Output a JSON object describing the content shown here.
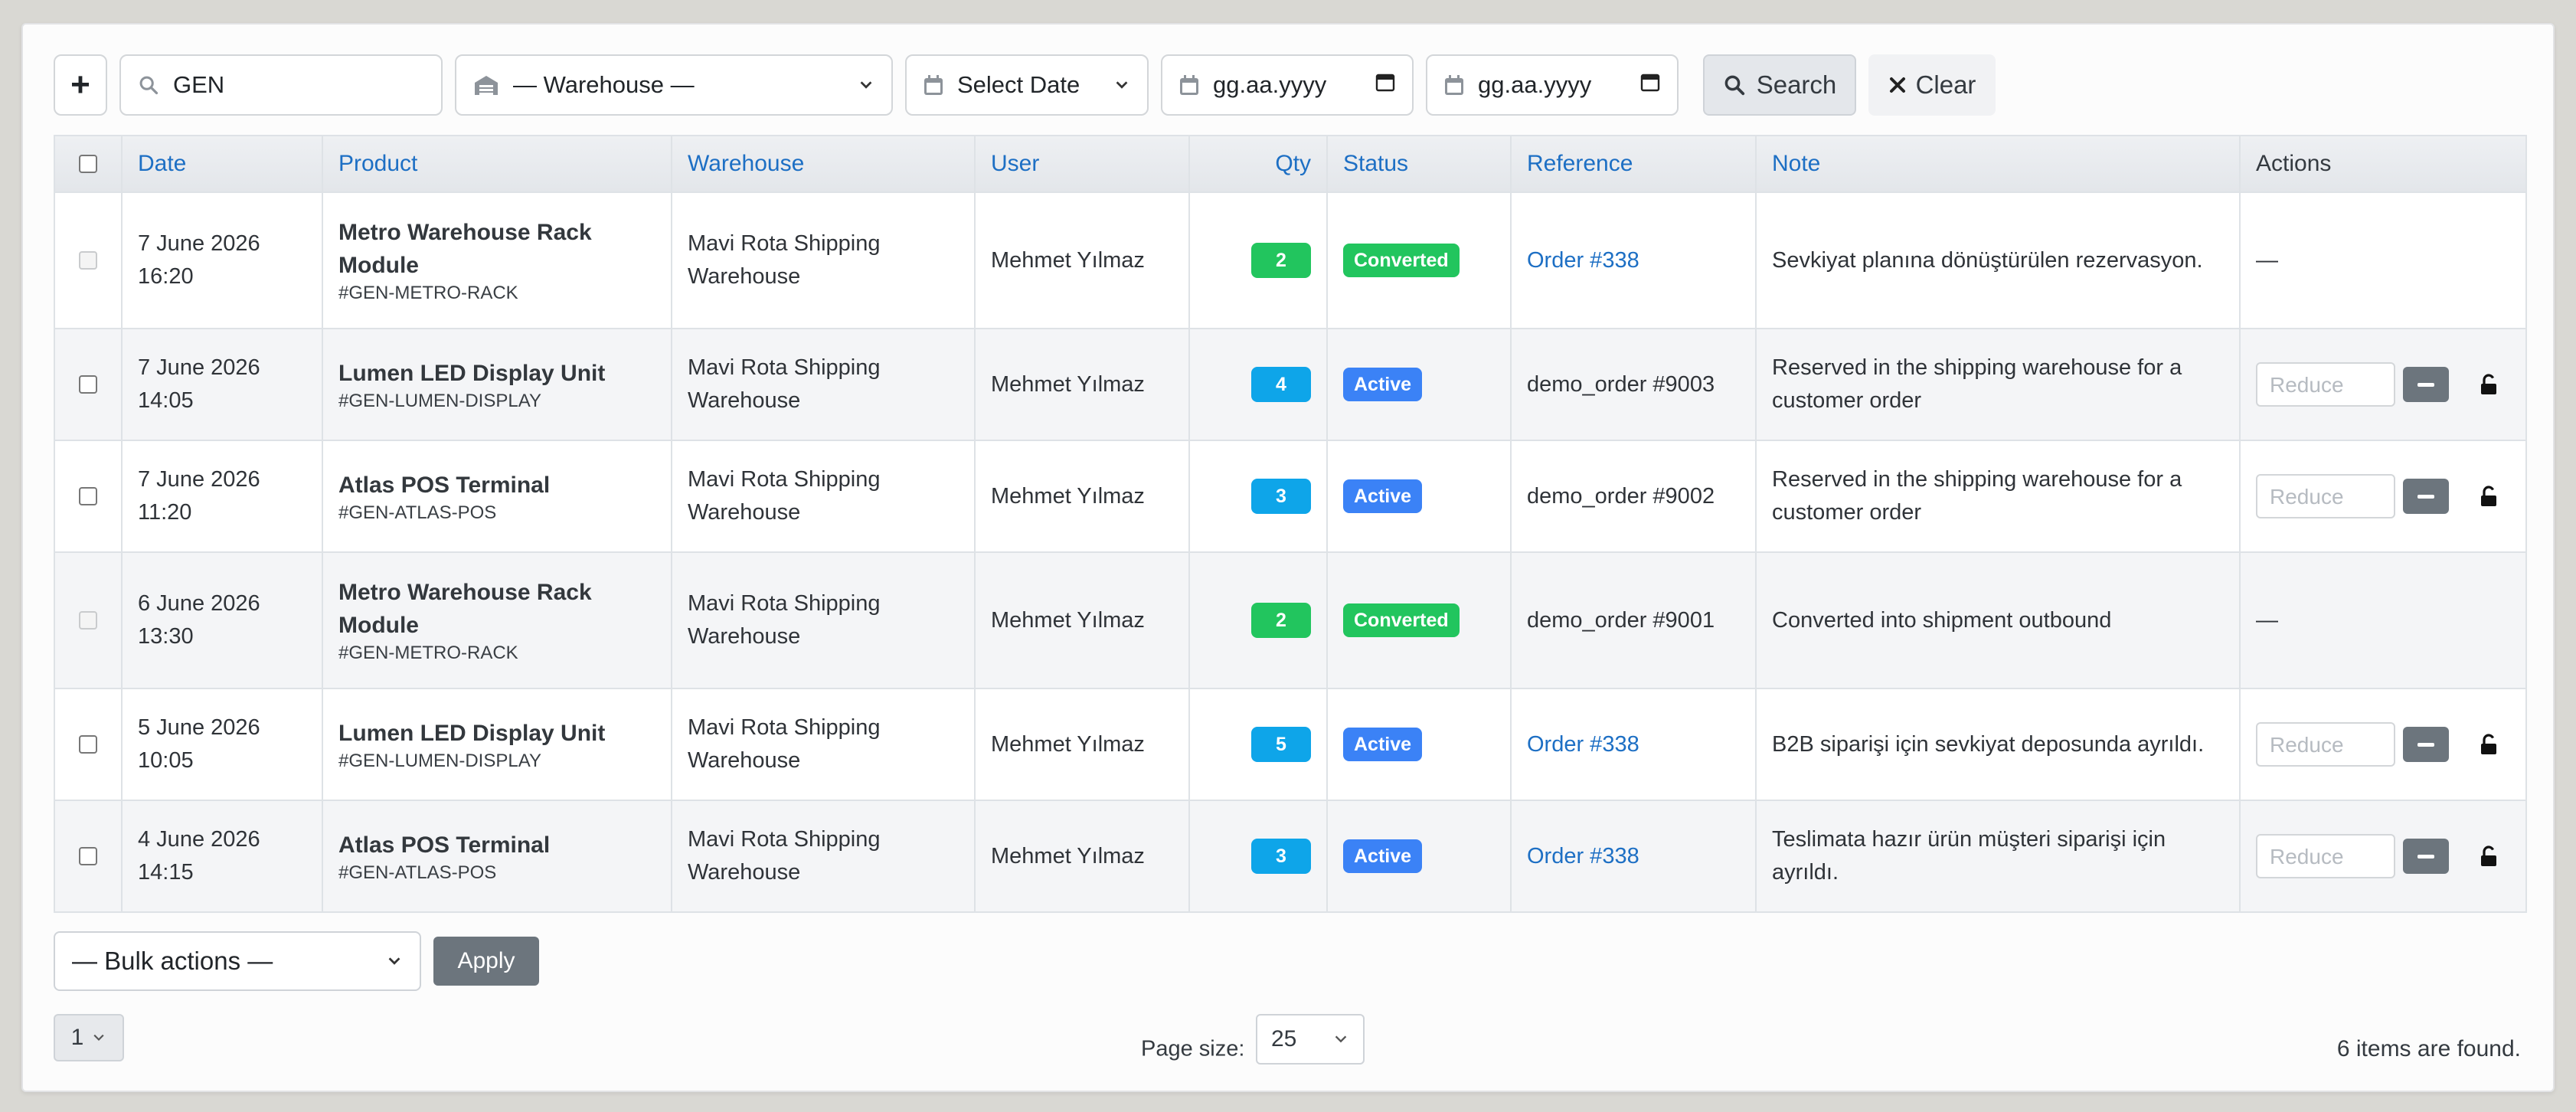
{
  "toolbar": {
    "add_label": "+",
    "search_value": "GEN",
    "warehouse_selected": "— Warehouse —",
    "date_selected": "Select Date",
    "date_from_placeholder": "gg.aa.yyyy",
    "date_to_placeholder": "gg.aa.yyyy",
    "search_label": "Search",
    "clear_label": "Clear"
  },
  "table": {
    "headers": {
      "date": "Date",
      "product": "Product",
      "warehouse": "Warehouse",
      "user": "User",
      "qty": "Qty",
      "status": "Status",
      "reference": "Reference",
      "note": "Note",
      "actions": "Actions"
    },
    "rows": [
      {
        "date": "7 June 2026",
        "time": "16:20",
        "product": "Metro Warehouse Rack Module",
        "sku": "#GEN-METRO-RACK",
        "warehouse": "Mavi Rota Shipping Warehouse",
        "user": "Mehmet Yılmaz",
        "qty": "2",
        "status": "Converted",
        "reference": "Order #338",
        "note": "Sevkiyat planına dönüştürülen rezervasyon.",
        "action": "—"
      },
      {
        "date": "7 June 2026",
        "time": "14:05",
        "product": "Lumen LED Display Unit",
        "sku": "#GEN-LUMEN-DISPLAY",
        "warehouse": "Mavi Rota Shipping Warehouse",
        "user": "Mehmet Yılmaz",
        "qty": "4",
        "status": "Active",
        "reference": "demo_order #9003",
        "note": "Reserved in the shipping warehouse for a customer order",
        "reduce_placeholder": "Reduce"
      },
      {
        "date": "7 June 2026",
        "time": "11:20",
        "product": "Atlas POS Terminal",
        "sku": "#GEN-ATLAS-POS",
        "warehouse": "Mavi Rota Shipping Warehouse",
        "user": "Mehmet Yılmaz",
        "qty": "3",
        "status": "Active",
        "reference": "demo_order #9002",
        "note": "Reserved in the shipping warehouse for a customer order",
        "reduce_placeholder": "Reduce"
      },
      {
        "date": "6 June 2026",
        "time": "13:30",
        "product": "Metro Warehouse Rack Module",
        "sku": "#GEN-METRO-RACK",
        "warehouse": "Mavi Rota Shipping Warehouse",
        "user": "Mehmet Yılmaz",
        "qty": "2",
        "status": "Converted",
        "reference": "demo_order #9001",
        "note": "Converted into shipment outbound",
        "action": "—"
      },
      {
        "date": "5 June 2026",
        "time": "10:05",
        "product": "Lumen LED Display Unit",
        "sku": "#GEN-LUMEN-DISPLAY",
        "warehouse": "Mavi Rota Shipping Warehouse",
        "user": "Mehmet Yılmaz",
        "qty": "5",
        "status": "Active",
        "reference": "Order #338",
        "note": "B2B siparişi için sevkiyat deposunda ayrıldı.",
        "reduce_placeholder": "Reduce"
      },
      {
        "date": "4 June 2026",
        "time": "14:15",
        "product": "Atlas POS Terminal",
        "sku": "#GEN-ATLAS-POS",
        "warehouse": "Mavi Rota Shipping Warehouse",
        "user": "Mehmet Yılmaz",
        "qty": "3",
        "status": "Active",
        "reference": "Order #338",
        "note": "Teslimata hazır ürün müşteri siparişi için ayrıldı.",
        "reduce_placeholder": "Reduce"
      }
    ]
  },
  "footer": {
    "bulk_selected": "— Bulk actions —",
    "apply_label": "Apply",
    "page": "1",
    "page_size_label": "Page size:",
    "page_size": "25",
    "found_text": "6 items are found."
  },
  "colors": {
    "link": "#1d6fc4",
    "converted": "#22c55e",
    "active": "#3b82f6",
    "qty_active": "#0ea5e9"
  },
  "icons": [
    "plus-icon",
    "search-icon",
    "warehouse-icon",
    "calendar-icon",
    "chevron-down-icon",
    "close-icon",
    "lock-icon",
    "minus-icon"
  ]
}
